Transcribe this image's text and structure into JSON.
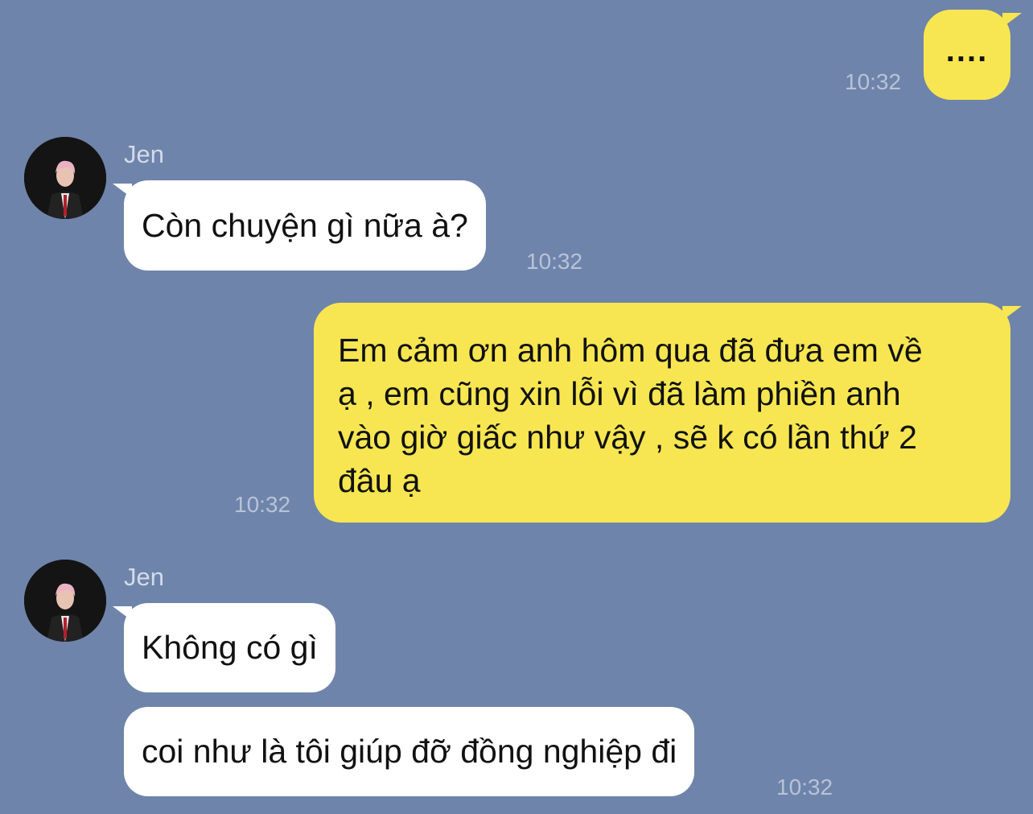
{
  "messages": [
    {
      "side": "outgoing",
      "text": "....",
      "time": "10:32"
    },
    {
      "side": "incoming",
      "sender": "Jen",
      "avatar": "profile-photo",
      "text": "Còn chuyện gì nữa à?",
      "time": "10:32"
    },
    {
      "side": "outgoing",
      "lines": [
        "Em cảm ơn anh hôm qua đã đưa em về",
        "ạ , em cũng xin lỗi vì đã làm phiền anh",
        "vào giờ giấc như vậy , sẽ k có lần thứ 2",
        "đâu ạ"
      ],
      "time": "10:32"
    },
    {
      "side": "incoming",
      "sender": "Jen",
      "avatar": "profile-photo",
      "text": "Không có gì"
    },
    {
      "side": "incoming",
      "text": "coi như là tôi giúp đỡ đồng nghiệp đi",
      "time": "10:32"
    }
  ],
  "colors": {
    "background": "#6f84aa",
    "outgoing_bubble": "#f7e651",
    "incoming_bubble": "#ffffff",
    "timestamp": "#b7c3d8",
    "sender_name": "#d2dbea"
  }
}
